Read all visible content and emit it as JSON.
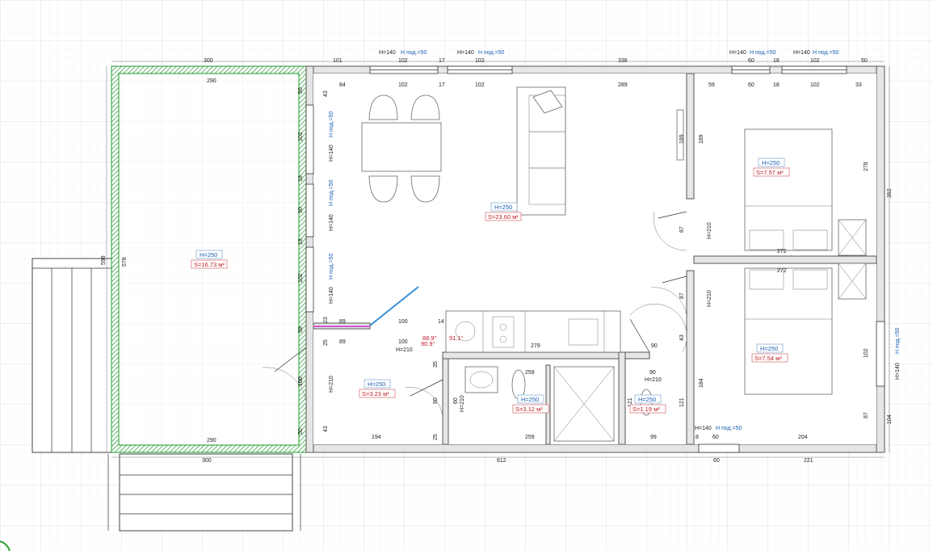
{
  "rooms": {
    "terrace": {
      "height": "H=250",
      "area": "S=16.73 м²"
    },
    "living": {
      "height": "H=250",
      "area": "S=23.60 м²"
    },
    "bedroom_top": {
      "height": "H=250",
      "area": "S=7.57 м²"
    },
    "bedroom_bottom": {
      "height": "H=250",
      "area": "S=7.54 м²"
    },
    "hall": {
      "height": "H=250",
      "area": "S=3.23 м²"
    },
    "bath": {
      "height": "H=250",
      "area": "S=3.12 м²"
    },
    "wc": {
      "height": "H=250",
      "area": "S=1.19 м²"
    }
  },
  "dimensions": {
    "top_outer": [
      "300",
      "101",
      "102",
      "17",
      "102",
      "338",
      "60",
      "18",
      "102",
      "50"
    ],
    "top_inner_living": [
      "84",
      "102",
      "17",
      "102",
      "289"
    ],
    "top_inner_bedroom": [
      "59",
      "60",
      "18",
      "102",
      "33"
    ],
    "terrace_top": "290",
    "terrace_bottom": "290",
    "terrace_side": "578",
    "terrace_outer_side": "598",
    "bottom_outer_left": "300",
    "bottom_outer_mid": "612",
    "bottom_outer_right_a": "60",
    "bottom_outer_right_b": "221",
    "right_outer": "392",
    "left_wall": [
      "50",
      "43",
      "102",
      "18",
      "90",
      "18",
      "102",
      "23",
      "58",
      "25",
      "100",
      "43",
      "50"
    ],
    "right_wall": [
      "278",
      "102",
      "87",
      "104"
    ],
    "partition_top": [
      "189",
      "87",
      "87",
      "43",
      "184",
      "87"
    ],
    "bedroom_widths": [
      "272",
      "272"
    ],
    "hall_row": [
      "89",
      "100",
      "14",
      "89",
      "100",
      "279",
      "90"
    ],
    "bottom_inner": [
      "194",
      "25",
      "259",
      "99",
      "8",
      "60",
      "204"
    ],
    "bath_row": [
      "259",
      "90"
    ],
    "vertical_misc": [
      "35",
      "80",
      "60",
      "121",
      "121",
      "80",
      "100"
    ],
    "angles": [
      "88.9°",
      "91.1°",
      "90.9°"
    ]
  },
  "openings": {
    "window_h": "H=140",
    "sill": "H под.=50",
    "door_h": "H=210"
  },
  "colors": {
    "terrace_border": "#1e9b2e",
    "height_text": "#1a5fb4",
    "area_text": "#c01c28",
    "grid": "#d9d9d9"
  }
}
